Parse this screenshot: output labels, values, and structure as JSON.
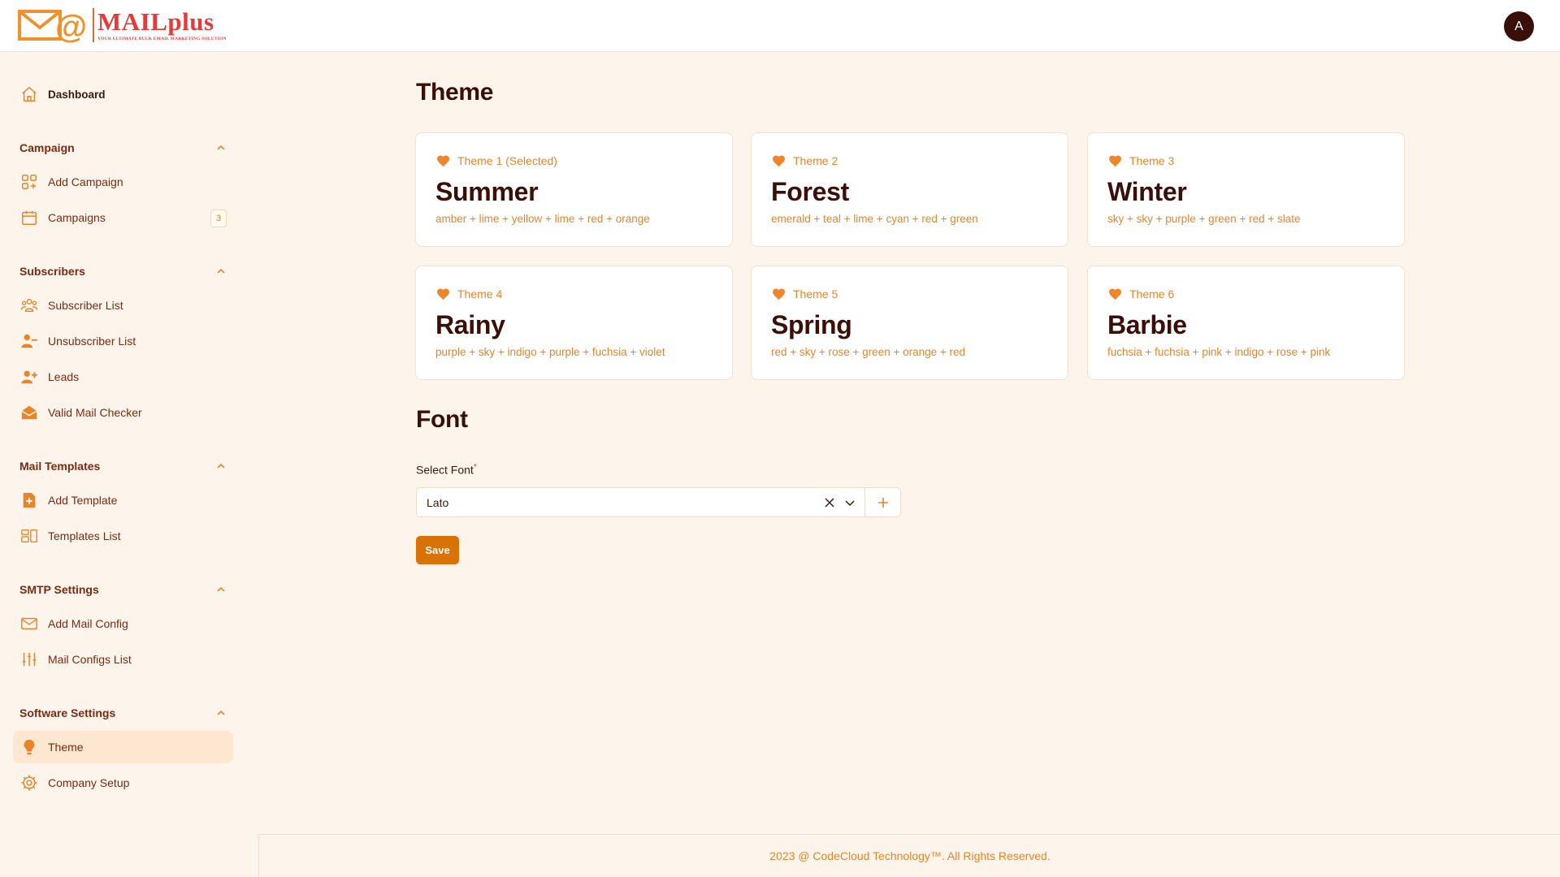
{
  "header": {
    "logo_name": "MAILplus",
    "logo_tagline": "YOUR ULTIMATE BULK EMAIL MARKETING SOLUTION",
    "avatar_initial": "A"
  },
  "sidebar": {
    "dashboard": "Dashboard",
    "sections": [
      {
        "title": "Campaign",
        "items": [
          {
            "label": "Add Campaign",
            "icon": "grid-plus-icon"
          },
          {
            "label": "Campaigns",
            "icon": "calendar-icon",
            "badge": "3"
          }
        ]
      },
      {
        "title": "Subscribers",
        "items": [
          {
            "label": "Subscriber List",
            "icon": "users-icon"
          },
          {
            "label": "Unsubscriber List",
            "icon": "user-minus-icon"
          },
          {
            "label": "Leads",
            "icon": "user-plus-icon"
          },
          {
            "label": "Valid Mail Checker",
            "icon": "mail-open-icon"
          }
        ]
      },
      {
        "title": "Mail Templates",
        "items": [
          {
            "label": "Add Template",
            "icon": "document-plus-icon"
          },
          {
            "label": "Templates List",
            "icon": "templates-icon"
          }
        ]
      },
      {
        "title": "SMTP Settings",
        "items": [
          {
            "label": "Add Mail Config",
            "icon": "envelope-icon"
          },
          {
            "label": "Mail Configs List",
            "icon": "sliders-icon"
          }
        ]
      },
      {
        "title": "Software Settings",
        "items": [
          {
            "label": "Theme",
            "icon": "lightbulb-icon",
            "active": true
          },
          {
            "label": "Company Setup",
            "icon": "cog-icon"
          }
        ]
      }
    ]
  },
  "theme": {
    "heading": "Theme",
    "cards": [
      {
        "tag": "Theme 1 (Selected)",
        "name": "Summer",
        "colors": "amber + lime + yellow + lime + red + orange"
      },
      {
        "tag": "Theme 2",
        "name": "Forest",
        "colors": "emerald + teal + lime + cyan + red + green"
      },
      {
        "tag": "Theme 3",
        "name": "Winter",
        "colors": "sky + sky + purple + green + red + slate"
      },
      {
        "tag": "Theme 4",
        "name": "Rainy",
        "colors": "purple + sky + indigo + purple + fuchsia + violet"
      },
      {
        "tag": "Theme 5",
        "name": "Spring",
        "colors": "red + sky + rose + green + orange + red"
      },
      {
        "tag": "Theme 6",
        "name": "Barbie",
        "colors": "fuchsia + fuchsia + pink + indigo + rose + pink"
      }
    ]
  },
  "font": {
    "heading": "Font",
    "label": "Select Font",
    "required_mark": "*",
    "selected": "Lato",
    "save_label": "Save"
  },
  "footer": {
    "text": "2023 @ CodeCloud Technology™. All Rights Reserved."
  },
  "colors": {
    "accent": "#e8852a",
    "primary_button": "#d97207",
    "text_dark": "#3a0f08",
    "background": "#fdf5ec"
  }
}
